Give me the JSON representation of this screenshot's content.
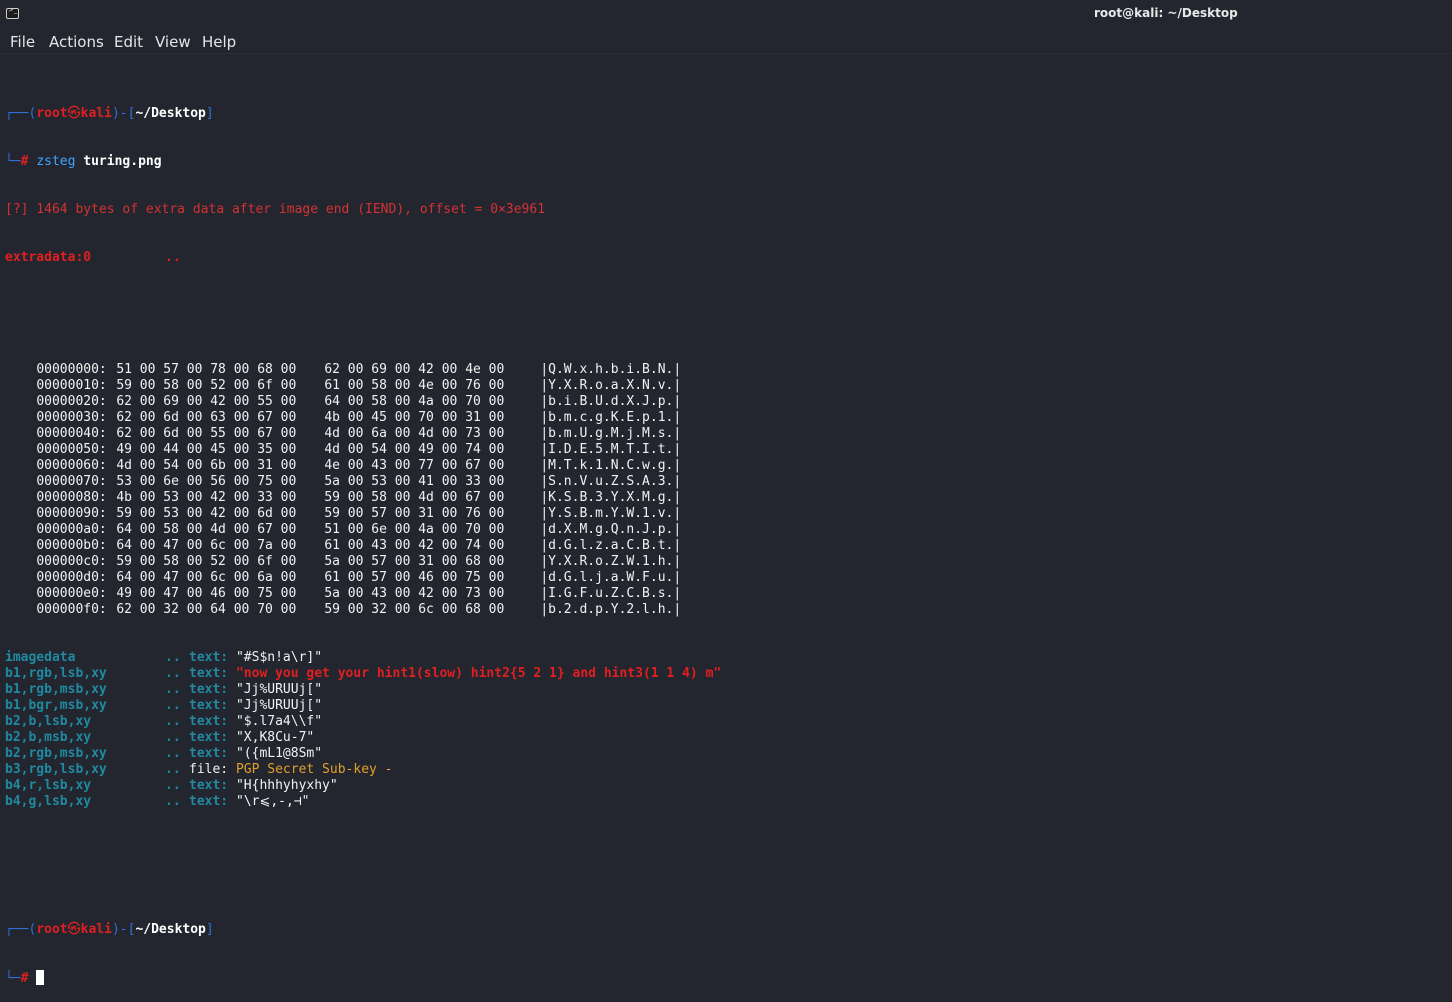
{
  "window": {
    "title": "root@kali: ~/Desktop",
    "icon": "terminal-icon"
  },
  "menu": [
    "File",
    "Actions",
    "Edit",
    "View",
    "Help"
  ],
  "prompt": {
    "user": "root",
    "at_symbol": "㉿",
    "host": "kali",
    "path": "~/Desktop",
    "hash": "#"
  },
  "command": {
    "program": "zsteg",
    "arg": "turing.png"
  },
  "warning": "[?] 1464 bytes of extra data after image end (IEND), offset = 0×3e961",
  "extradata": {
    "label": "extradata:0",
    "dots": ".."
  },
  "hexdump": [
    {
      "offset": "00000000:",
      "a": "51 00 57 00 78 00 68 00",
      "b": "62 00 69 00 42 00 4e 00",
      "ascii": "|Q.W.x.h.b.i.B.N.|"
    },
    {
      "offset": "00000010:",
      "a": "59 00 58 00 52 00 6f 00",
      "b": "61 00 58 00 4e 00 76 00",
      "ascii": "|Y.X.R.o.a.X.N.v.|"
    },
    {
      "offset": "00000020:",
      "a": "62 00 69 00 42 00 55 00",
      "b": "64 00 58 00 4a 00 70 00",
      "ascii": "|b.i.B.U.d.X.J.p.|"
    },
    {
      "offset": "00000030:",
      "a": "62 00 6d 00 63 00 67 00",
      "b": "4b 00 45 00 70 00 31 00",
      "ascii": "|b.m.c.g.K.E.p.1.|"
    },
    {
      "offset": "00000040:",
      "a": "62 00 6d 00 55 00 67 00",
      "b": "4d 00 6a 00 4d 00 73 00",
      "ascii": "|b.m.U.g.M.j.M.s.|"
    },
    {
      "offset": "00000050:",
      "a": "49 00 44 00 45 00 35 00",
      "b": "4d 00 54 00 49 00 74 00",
      "ascii": "|I.D.E.5.M.T.I.t.|"
    },
    {
      "offset": "00000060:",
      "a": "4d 00 54 00 6b 00 31 00",
      "b": "4e 00 43 00 77 00 67 00",
      "ascii": "|M.T.k.1.N.C.w.g.|"
    },
    {
      "offset": "00000070:",
      "a": "53 00 6e 00 56 00 75 00",
      "b": "5a 00 53 00 41 00 33 00",
      "ascii": "|S.n.V.u.Z.S.A.3.|"
    },
    {
      "offset": "00000080:",
      "a": "4b 00 53 00 42 00 33 00",
      "b": "59 00 58 00 4d 00 67 00",
      "ascii": "|K.S.B.3.Y.X.M.g.|"
    },
    {
      "offset": "00000090:",
      "a": "59 00 53 00 42 00 6d 00",
      "b": "59 00 57 00 31 00 76 00",
      "ascii": "|Y.S.B.m.Y.W.1.v.|"
    },
    {
      "offset": "000000a0:",
      "a": "64 00 58 00 4d 00 67 00",
      "b": "51 00 6e 00 4a 00 70 00",
      "ascii": "|d.X.M.g.Q.n.J.p.|"
    },
    {
      "offset": "000000b0:",
      "a": "64 00 47 00 6c 00 7a 00",
      "b": "61 00 43 00 42 00 74 00",
      "ascii": "|d.G.l.z.a.C.B.t.|"
    },
    {
      "offset": "000000c0:",
      "a": "59 00 58 00 52 00 6f 00",
      "b": "5a 00 57 00 31 00 68 00",
      "ascii": "|Y.X.R.o.Z.W.1.h.|"
    },
    {
      "offset": "000000d0:",
      "a": "64 00 47 00 6c 00 6a 00",
      "b": "61 00 57 00 46 00 75 00",
      "ascii": "|d.G.l.j.a.W.F.u.|"
    },
    {
      "offset": "000000e0:",
      "a": "49 00 47 00 46 00 75 00",
      "b": "5a 00 43 00 42 00 73 00",
      "ascii": "|I.G.F.u.Z.C.B.s.|"
    },
    {
      "offset": "000000f0:",
      "a": "62 00 32 00 64 00 70 00",
      "b": "59 00 32 00 6c 00 68 00",
      "ascii": "|b.2.d.p.Y.2.l.h.|"
    }
  ],
  "results": [
    {
      "label": "imagedata",
      "dots": "..",
      "kind": "text:",
      "value": "\"#S$n!a\\r]\"",
      "highlight": false
    },
    {
      "label": "b1,rgb,lsb,xy",
      "dots": "..",
      "kind": "text:",
      "value": "\"now you get your hint1(slow) hint2{5 2 1} and hint3(1 1 4) m\"",
      "highlight": true
    },
    {
      "label": "b1,rgb,msb,xy",
      "dots": "..",
      "kind": "text:",
      "value": "\"Jj%URUUj[\"",
      "highlight": false
    },
    {
      "label": "b1,bgr,msb,xy",
      "dots": "..",
      "kind": "text:",
      "value": "\"Jj%URUUj[\"",
      "highlight": false
    },
    {
      "label": "b2,b,lsb,xy",
      "dots": "..",
      "kind": "text:",
      "value": "\"$.l7a4\\\\f\"",
      "highlight": false
    },
    {
      "label": "b2,b,msb,xy",
      "dots": "..",
      "kind": "text:",
      "value": "\"X,K8Cu-7\"",
      "highlight": false
    },
    {
      "label": "b2,rgb,msb,xy",
      "dots": "..",
      "kind": "text:",
      "value": "\"({mL1@8Sm\"",
      "highlight": false
    },
    {
      "label": "b3,rgb,lsb,xy",
      "dots": "..",
      "kind": "file:",
      "value": "PGP Secret Sub-key -",
      "highlight": false,
      "file": true
    },
    {
      "label": "b4,r,lsb,xy",
      "dots": "..",
      "kind": "text:",
      "value": "\"H{hhhyhyxhy\"",
      "highlight": false
    },
    {
      "label": "b4,g,lsb,xy",
      "dots": "..",
      "kind": "text:",
      "value": "\"\\r⩽,-,⊣\"",
      "highlight": false
    }
  ],
  "colors": {
    "background": "#23252f",
    "prompt_blue": "#2f6fd6",
    "prompt_red": "#e02020",
    "label_teal": "#1f8aa0",
    "file_orange": "#e39f2c"
  }
}
